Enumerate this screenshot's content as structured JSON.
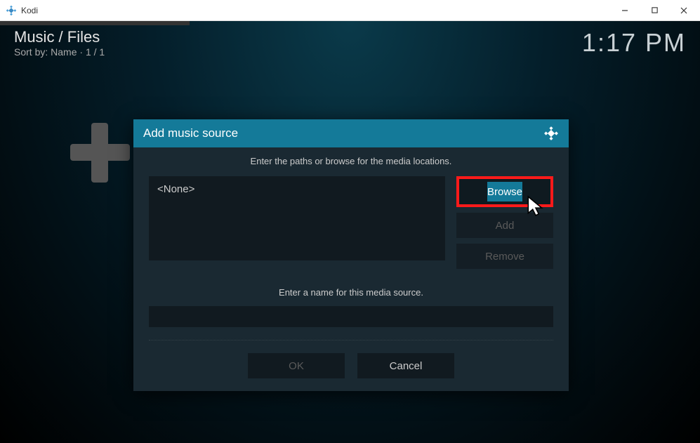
{
  "window": {
    "title": "Kodi"
  },
  "header": {
    "path": "Music / Files",
    "sort_label": "Sort by: Name",
    "page_indicator": "1 / 1",
    "clock": "1:17 PM"
  },
  "modal": {
    "title": "Add music source",
    "instruction_top": "Enter the paths or browse for the media locations.",
    "source_placeholder": "<None>",
    "buttons": {
      "browse": "Browse",
      "add": "Add",
      "remove": "Remove"
    },
    "instruction_name": "Enter a name for this media source.",
    "name_value": "",
    "ok": "OK",
    "cancel": "Cancel"
  }
}
